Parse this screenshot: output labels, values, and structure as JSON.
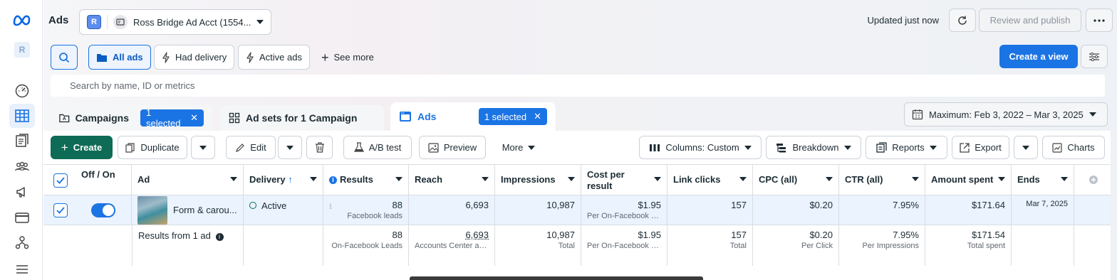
{
  "app": {
    "title": "Ads",
    "account_badge": "R",
    "rail_account_badge": "R"
  },
  "header": {
    "account_name": "Ross Bridge Ad Acct (1554...",
    "updated_text": "Updated just now",
    "review_label": "Review and publish"
  },
  "filters": {
    "all_ads": "All ads",
    "had_delivery": "Had delivery",
    "active_ads": "Active ads",
    "see_more": "See more",
    "create_view": "Create a view"
  },
  "search": {
    "placeholder": "Search by name, ID or metrics"
  },
  "tabs": [
    {
      "label": "Campaigns",
      "selected": "1 selected"
    },
    {
      "label": "Ad sets for 1 Campaign"
    },
    {
      "label": "Ads",
      "selected": "1 selected"
    }
  ],
  "date_range": "Maximum: Feb 3, 2022 – Mar 3, 2025",
  "toolbar": {
    "create": "Create",
    "duplicate": "Duplicate",
    "edit": "Edit",
    "ab_test": "A/B test",
    "preview": "Preview",
    "more": "More",
    "columns": "Columns: Custom",
    "breakdown": "Breakdown",
    "reports": "Reports",
    "export": "Export",
    "charts": "Charts"
  },
  "table": {
    "headers": {
      "offon": "Off / On",
      "ad": "Ad",
      "delivery": "Delivery",
      "results": "Results",
      "reach": "Reach",
      "impressions": "Impressions",
      "cost_per_result": "Cost per result",
      "link_clicks": "Link clicks",
      "cpc": "CPC (all)",
      "ctr": "CTR (all)",
      "amount_spent": "Amount spent",
      "ends": "Ends"
    },
    "row": {
      "ad_name": "Form & carou...",
      "delivery": "Active",
      "results": "88",
      "results_sub": "Facebook leads",
      "reach": "6,693",
      "impressions": "10,987",
      "cost_per_result": "$1.95",
      "cost_sub": "Per On-Facebook Le...",
      "link_clicks": "157",
      "cpc": "$0.20",
      "ctr": "7.95%",
      "amount_spent": "$171.64",
      "ends": "Mar 7, 2025"
    },
    "totals": {
      "label": "Results from 1 ad",
      "results": "88",
      "results_sub": "On-Facebook Leads",
      "reach": "6,693",
      "reach_sub": "Accounts Center acc...",
      "impressions": "10,987",
      "impressions_sub": "Total",
      "cost_per_result": "$1.95",
      "cost_sub": "Per On-Facebook Le...",
      "link_clicks": "157",
      "link_clicks_sub": "Total",
      "cpc": "$0.20",
      "cpc_sub": "Per Click",
      "ctr": "7.95%",
      "ctr_sub": "Per Impressions",
      "amount_spent": "$171.54",
      "amount_sub": "Total spent"
    }
  },
  "colors": {
    "accent": "#1b74e4",
    "create_green": "#0e6b55",
    "row_highlight": "#eaf3fe"
  }
}
